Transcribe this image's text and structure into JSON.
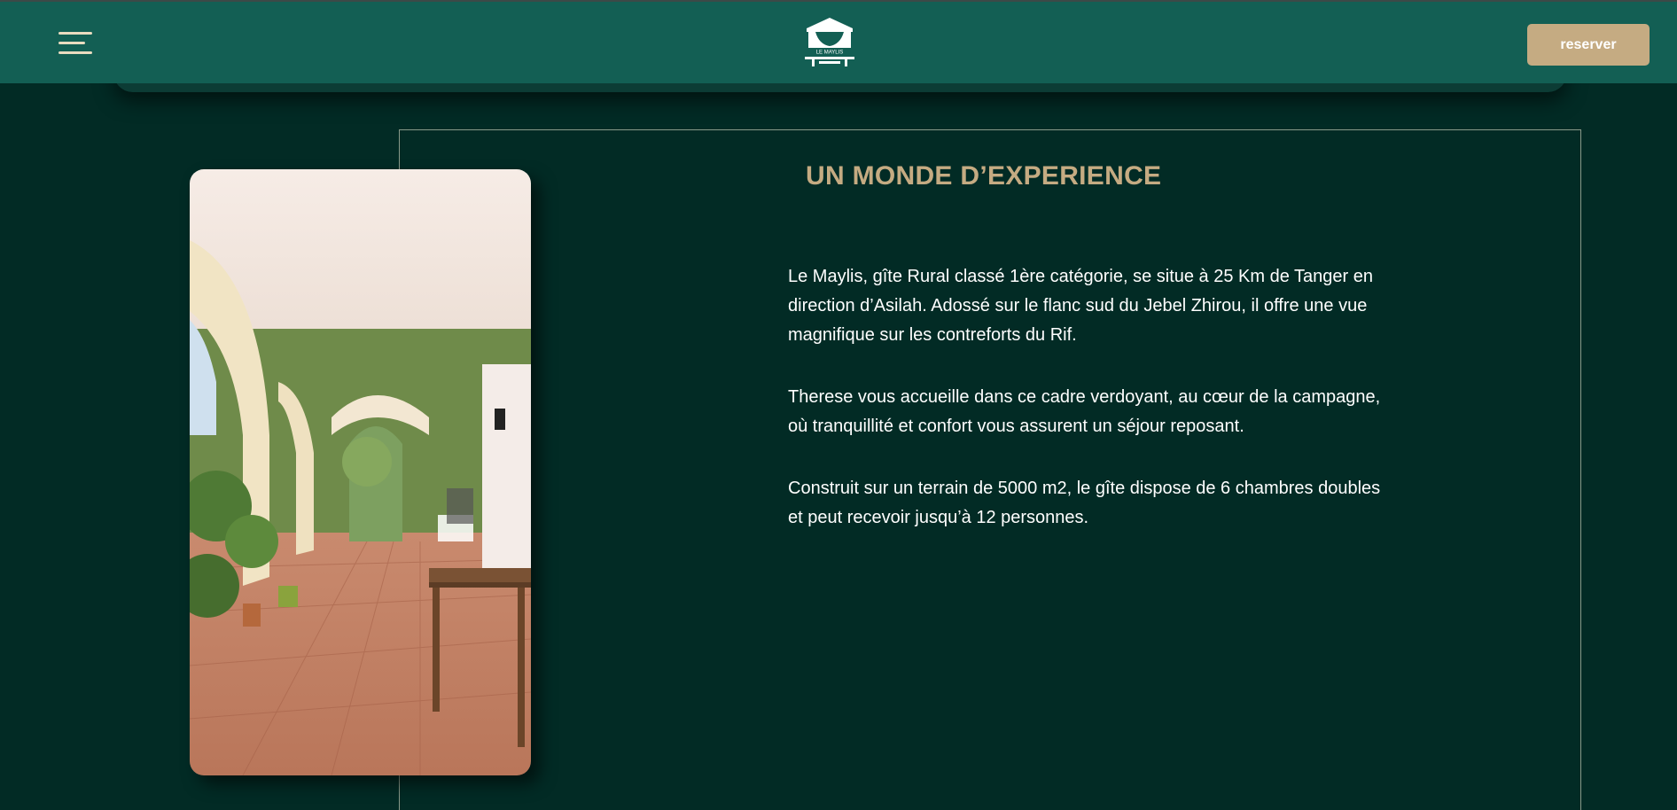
{
  "header": {
    "menu_icon": "hamburger-menu-icon",
    "logo_text": "LE MAYLIS",
    "reserve_label": "reserver"
  },
  "section": {
    "title": "UN MONDE D’EXPERIENCE",
    "paragraphs": [
      "Le Maylis, gîte Rural classé 1ère catégorie, se situe à 25 Km de Tanger en direction d’Asilah. Adossé sur le flanc sud du Jebel Zhirou, il offre une vue magnifique sur les contreforts du Rif.",
      "Therese vous accueille dans ce cadre verdoyant, au cœur de la campagne, où tranquillité et confort vous assurent un séjour reposant.",
      "Construit sur un terrain de 5000 m2, le gîte dispose de 6 chambres doubles et peut recevoir jusqu’à 12 personnes."
    ]
  },
  "colors": {
    "header_bg": "#135f54",
    "page_bg": "#022b25",
    "accent": "#c5ab82",
    "text": "#ffffff"
  }
}
